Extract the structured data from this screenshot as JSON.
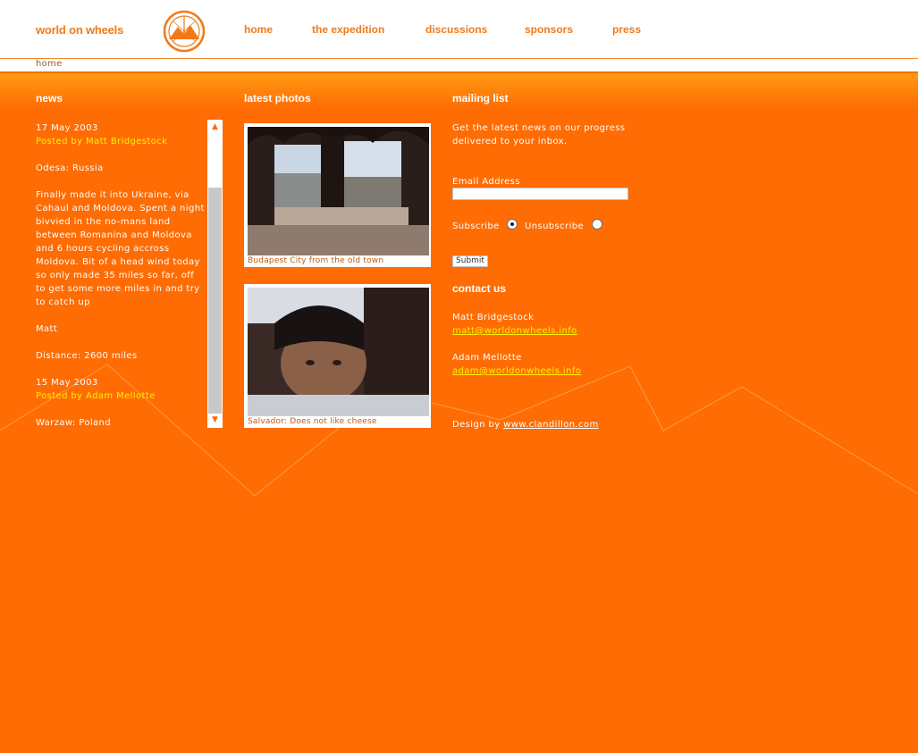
{
  "header": {
    "brand": "world on wheels",
    "nav": [
      "home",
      "the expedition",
      "discussions",
      "sponsors",
      "press"
    ],
    "breadcrumb": "home"
  },
  "news": {
    "title": "news",
    "entries": [
      {
        "date": "17 May 2003",
        "posted_by": "Posted by Matt Bridgestock",
        "location": "Odesa: Russia",
        "body": "Finally made it into Ukraine, via Cahaul and Moldova. Spent a night bivvied in the no-mans land between Romanina and Moldova and 6 hours cycling accross Moldova. Bit of a head wind today so only made 35 miles so far, off to get some more miles in and try to catch up",
        "signoff": "Matt",
        "distance": "Distance: 2600 miles"
      },
      {
        "date": "15 May 2003",
        "posted_by": "Posted by Adam Mellotte",
        "location": "Warzaw: Poland"
      }
    ]
  },
  "photos": {
    "title": "latest photos",
    "items": [
      {
        "caption": "Budapest City from the old town"
      },
      {
        "caption": "Salvador: Does not like cheese"
      }
    ]
  },
  "mailing": {
    "title": "mailing list",
    "intro": "Get the latest news on our progress delivered to your inbox.",
    "email_label": "Email Address",
    "email_value": "",
    "subscribe_label": "Subscribe",
    "unsubscribe_label": "Unsubscribe",
    "selected": "subscribe",
    "submit_label": "Submit"
  },
  "contact": {
    "title": "contact us",
    "people": [
      {
        "name": "Matt Bridgestock",
        "email": "matt@worldonwheels.info"
      },
      {
        "name": "Adam Mellotte",
        "email": "adam@worldonwheels.info"
      }
    ],
    "credit_prefix": "Design by",
    "credit_link": "www.clandillon.com"
  },
  "colors": {
    "background": "#fe6c03",
    "brand_orange": "#f07a1a",
    "highlight_yellow": "#fff200"
  }
}
